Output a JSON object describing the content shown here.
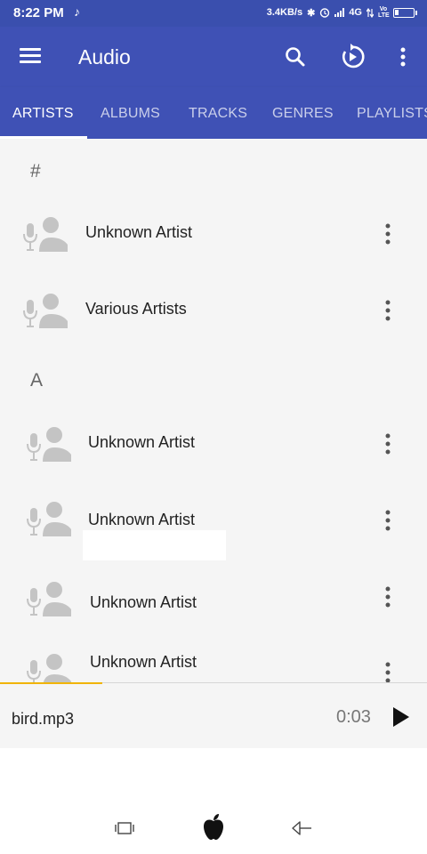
{
  "status_bar": {
    "time": "8:22 PM",
    "music_note": "♪",
    "network_speed": "3.4KB/s",
    "bluetooth": "✱",
    "network_type": "4G",
    "volte": "Vo LTE"
  },
  "toolbar": {
    "title": "Audio",
    "icons": [
      "menu-icon",
      "search-icon",
      "resume-playback-icon",
      "more-vert-icon"
    ]
  },
  "tabs": [
    {
      "label": "ARTISTS",
      "active": true
    },
    {
      "label": "ALBUMS",
      "active": false
    },
    {
      "label": "TRACKS",
      "active": false
    },
    {
      "label": "GENRES",
      "active": false
    },
    {
      "label": "PLAYLISTS",
      "active": false
    }
  ],
  "sections": [
    {
      "header": "#"
    },
    {
      "header": "A"
    }
  ],
  "artists": [
    {
      "name": "Unknown Artist"
    },
    {
      "name": "Various Artists"
    },
    {
      "name": "Unknown Artist"
    },
    {
      "name": "Unknown Artist"
    },
    {
      "name": "Unknown Artist"
    },
    {
      "name": "Unknown Artist"
    }
  ],
  "mini_player": {
    "track": "bird.mp3",
    "elapsed": "0:03",
    "progress_fraction": 0.24,
    "accent_color": "#f0b400"
  },
  "navigation_bar": {
    "icons": [
      "recents-icon",
      "home-apple-icon",
      "back-icon"
    ]
  },
  "colors": {
    "primary": "#3f51b5",
    "status_bar": "#3a4fae",
    "list_background": "#f5f5f5",
    "avatar_gray": "#c4c4c4"
  }
}
